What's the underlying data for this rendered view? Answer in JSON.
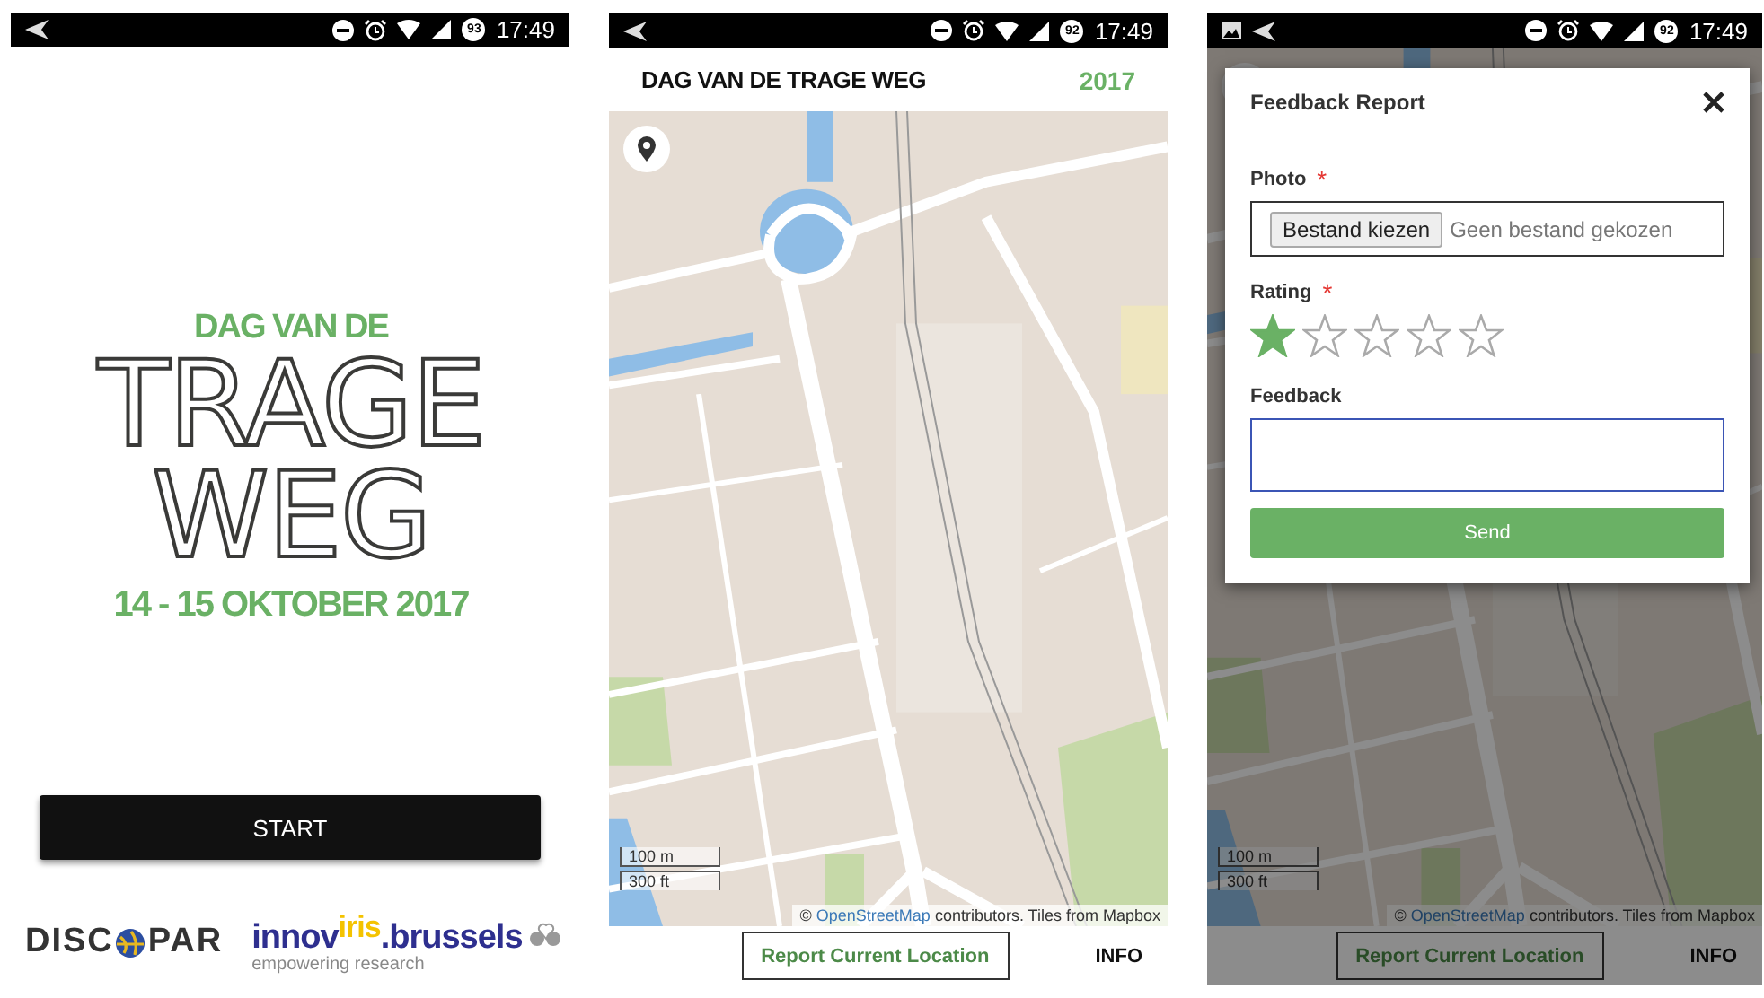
{
  "screens": [
    {
      "kind": "splash",
      "status_bar": {
        "battery": "93",
        "time": "17:49"
      },
      "logo": {
        "line_1": "DAG VAN DE",
        "line_2": "TRAGE",
        "line_3": "WEG",
        "dates": "14 - 15 OKTOBER 2017"
      },
      "start_button": "START",
      "sponsors": {
        "discopar": {
          "before": "DISC",
          "after": "PAR"
        },
        "innoviris": {
          "name": "innov$^{iris}$.brussels",
          "tagline": "empowering research"
        }
      }
    },
    {
      "kind": "map",
      "status_bar": {
        "battery": "92",
        "time": "17:49"
      },
      "header": {
        "title": "DAG VAN DE TRAGE WEG",
        "year": "2017"
      },
      "map": {
        "scale_metric": "100 m",
        "scale_imperial": "300 ft",
        "attribution": {
          "prefix": "©",
          "link": "OpenStreetMap",
          "suffix": "contributors. Tiles from Mapbox"
        }
      },
      "bottom_bar": {
        "report_button": "Report Current Location",
        "info_link": "INFO"
      }
    },
    {
      "kind": "feedback",
      "status_bar": {
        "image_notification": true,
        "battery": "92",
        "time": "17:49"
      },
      "map": {
        "scale_metric": "100 m",
        "scale_imperial": "300 ft",
        "attribution": {
          "prefix": "©",
          "link": "OpenStreetMap",
          "suffix": "contributors. Tiles from Mapbox"
        }
      },
      "bottom_bar": {
        "report_button": "Report Current Location",
        "info_link": "INFO"
      },
      "dialog": {
        "title": "Feedback Report",
        "photo": {
          "label": "Photo",
          "required_mark": "*",
          "button": "Bestand kiezen",
          "status": "Geen bestand gekozen"
        },
        "rating": {
          "label": "Rating",
          "required_mark": "*",
          "stars": 1
        },
        "feedback": {
          "label": "Feedback",
          "focused": true
        },
        "send_button": "Send"
      }
    }
  ]
}
